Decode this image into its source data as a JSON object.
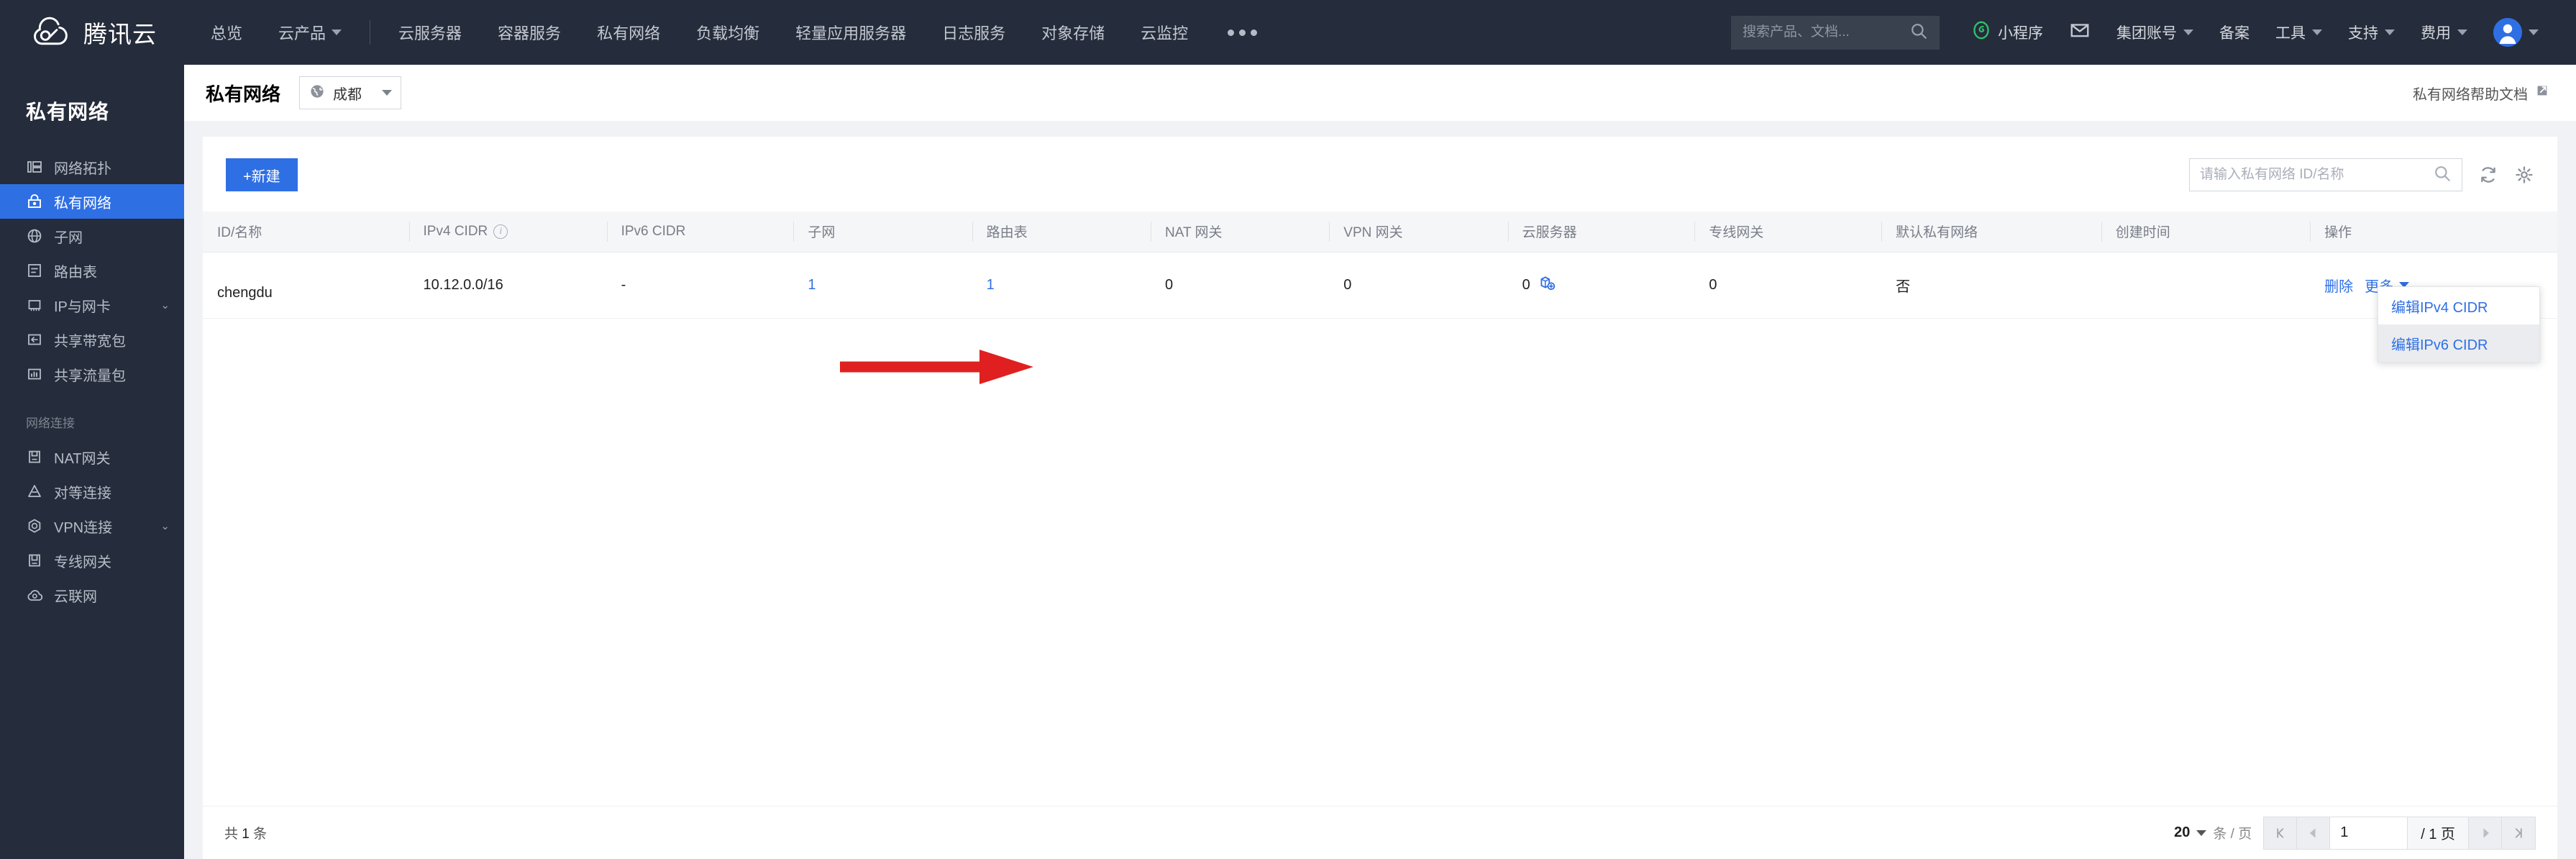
{
  "topnav": {
    "brand": "腾讯云",
    "brand_icon": "tencent-cloud-logo",
    "items": [
      {
        "label": "总览",
        "has_caret": false
      },
      {
        "label": "云产品",
        "has_caret": true
      },
      {
        "label": "云服务器",
        "has_caret": false
      },
      {
        "label": "容器服务",
        "has_caret": false
      },
      {
        "label": "私有网络",
        "has_caret": false
      },
      {
        "label": "负载均衡",
        "has_caret": false
      },
      {
        "label": "轻量应用服务器",
        "has_caret": false
      },
      {
        "label": "日志服务",
        "has_caret": false
      },
      {
        "label": "对象存储",
        "has_caret": false
      },
      {
        "label": "云监控",
        "has_caret": false
      }
    ],
    "more_icon": "ellipsis-icon",
    "search": {
      "placeholder": "搜索产品、文档...",
      "value": "",
      "icon": "search-icon"
    },
    "right_items": [
      {
        "label": "小程序",
        "icon": "mini-program-icon",
        "has_caret": false
      },
      {
        "label": "",
        "icon": "mail-icon",
        "has_caret": false
      },
      {
        "label": "集团账号",
        "icon": "",
        "has_caret": true
      },
      {
        "label": "备案",
        "icon": "",
        "has_caret": false
      },
      {
        "label": "工具",
        "icon": "",
        "has_caret": true
      },
      {
        "label": "支持",
        "icon": "",
        "has_caret": true
      },
      {
        "label": "费用",
        "icon": "",
        "has_caret": true
      }
    ],
    "avatar_icon": "user-avatar-icon"
  },
  "sidebar": {
    "title": "私有网络",
    "items": [
      {
        "label": "网络拓扑",
        "icon": "topology-icon",
        "active": false,
        "chevron": false
      },
      {
        "label": "私有网络",
        "icon": "lock-icon",
        "active": true,
        "chevron": false
      },
      {
        "label": "子网",
        "icon": "globe-icon",
        "active": false,
        "chevron": false
      },
      {
        "label": "路由表",
        "icon": "route-table-icon",
        "active": false,
        "chevron": false
      },
      {
        "label": "IP与网卡",
        "icon": "nic-icon",
        "active": false,
        "chevron": true
      },
      {
        "label": "共享带宽包",
        "icon": "bandwidth-icon",
        "active": false,
        "chevron": false
      },
      {
        "label": "共享流量包",
        "icon": "traffic-icon",
        "active": false,
        "chevron": false
      }
    ],
    "group_label": "网络连接",
    "group_items": [
      {
        "label": "NAT网关",
        "icon": "nat-gateway-icon",
        "active": false,
        "chevron": false
      },
      {
        "label": "对等连接",
        "icon": "peering-icon",
        "active": false,
        "chevron": false
      },
      {
        "label": "VPN连接",
        "icon": "vpn-icon",
        "active": false,
        "chevron": true
      },
      {
        "label": "专线网关",
        "icon": "direct-connect-icon",
        "active": false,
        "chevron": false
      },
      {
        "label": "云联网",
        "icon": "ccn-icon",
        "active": false,
        "chevron": false
      }
    ]
  },
  "page_header": {
    "title": "私有网络",
    "region": {
      "label": "成都",
      "icon": "region-globe-icon"
    },
    "help_link": {
      "label": "私有网络帮助文档",
      "icon": "external-link-icon"
    }
  },
  "toolbar": {
    "create_label": "+新建",
    "search": {
      "placeholder": "请输入私有网络 ID/名称",
      "value": "",
      "icon": "search-icon"
    },
    "refresh_icon": "refresh-icon",
    "settings_icon": "gear-icon"
  },
  "table": {
    "columns": [
      {
        "label": "ID/名称",
        "info": false
      },
      {
        "label": "IPv4 CIDR",
        "info": true
      },
      {
        "label": "IPv6 CIDR",
        "info": false
      },
      {
        "label": "子网",
        "info": false
      },
      {
        "label": "路由表",
        "info": false
      },
      {
        "label": "NAT 网关",
        "info": false
      },
      {
        "label": "VPN 网关",
        "info": false
      },
      {
        "label": "云服务器",
        "info": false
      },
      {
        "label": "专线网关",
        "info": false
      },
      {
        "label": "默认私有网络",
        "info": false
      },
      {
        "label": "创建时间",
        "info": false
      },
      {
        "label": "操作",
        "info": false
      }
    ],
    "rows": [
      {
        "id": "",
        "name": "chengdu",
        "ipv4_cidr": "10.12.0.0/16",
        "ipv6_cidr": "-",
        "subnet": "1",
        "route_table": "1",
        "nat_gateway": "0",
        "vpn_gateway": "0",
        "cloud_server": "0",
        "cloud_server_icon": "add-instance-icon",
        "direct_connect_gateway": "0",
        "is_default": "否",
        "create_time": "",
        "ops": {
          "delete_label": "删除",
          "more_label": "更多"
        }
      }
    ]
  },
  "more_menu": {
    "items": [
      {
        "label": "编辑IPv4 CIDR",
        "hovered": false
      },
      {
        "label": "编辑IPv6 CIDR",
        "hovered": true
      }
    ]
  },
  "annotation": {
    "arrow_color": "#e02020",
    "points_to": "编辑IPv6 CIDR"
  },
  "footer": {
    "total_prefix": "共",
    "total_count": "1",
    "total_suffix": "条",
    "page_size": "20",
    "page_size_unit": "条 / 页",
    "current_page": "1",
    "total_pages_label": "/ 1 页",
    "first_icon": "first-page-icon",
    "prev_icon": "prev-page-icon",
    "next_icon": "next-page-icon",
    "last_icon": "last-page-icon"
  },
  "colors": {
    "brand_blue": "#2f6fe4",
    "nav_dark": "#252c3b",
    "page_bg": "#f0f2f5",
    "arrow_red": "#e02020"
  }
}
